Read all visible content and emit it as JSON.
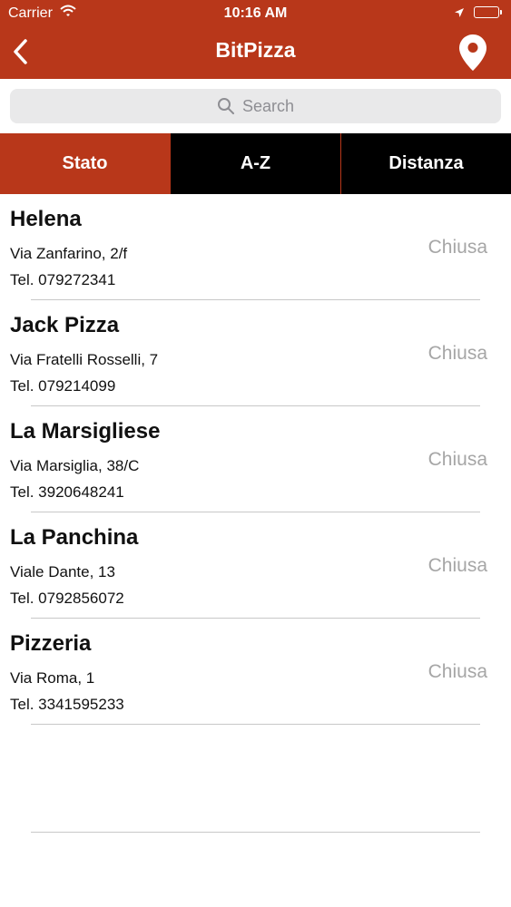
{
  "status_bar": {
    "carrier": "Carrier",
    "time": "10:16 AM"
  },
  "nav": {
    "title": "BitPizza"
  },
  "search": {
    "placeholder": "Search"
  },
  "tabs": [
    {
      "label": "Stato",
      "active": true
    },
    {
      "label": "A-Z",
      "active": false
    },
    {
      "label": "Distanza",
      "active": false
    }
  ],
  "pizzerias": [
    {
      "name": "Helena",
      "address": "Via Zanfarino, 2/f",
      "phone": "Tel. 079272341",
      "status": "Chiusa"
    },
    {
      "name": "Jack Pizza",
      "address": "Via Fratelli Rosselli, 7",
      "phone": "Tel. 079214099",
      "status": "Chiusa"
    },
    {
      "name": "La Marsigliese",
      "address": "Via Marsiglia, 38/C",
      "phone": "Tel. 3920648241",
      "status": "Chiusa"
    },
    {
      "name": "La Panchina",
      "address": "Viale Dante, 13",
      "phone": "Tel. 0792856072",
      "status": "Chiusa"
    },
    {
      "name": "Pizzeria",
      "address": "Via Roma, 1",
      "phone": "Tel. 3341595233",
      "status": "Chiusa"
    }
  ],
  "colors": {
    "accent": "#b8371a",
    "tab_inactive": "#000000",
    "status_closed": "#a6a6a6"
  },
  "icons": [
    "wifi-icon",
    "location-arrow-icon",
    "battery-icon",
    "back-chevron-icon",
    "map-pin-icon",
    "search-icon"
  ]
}
